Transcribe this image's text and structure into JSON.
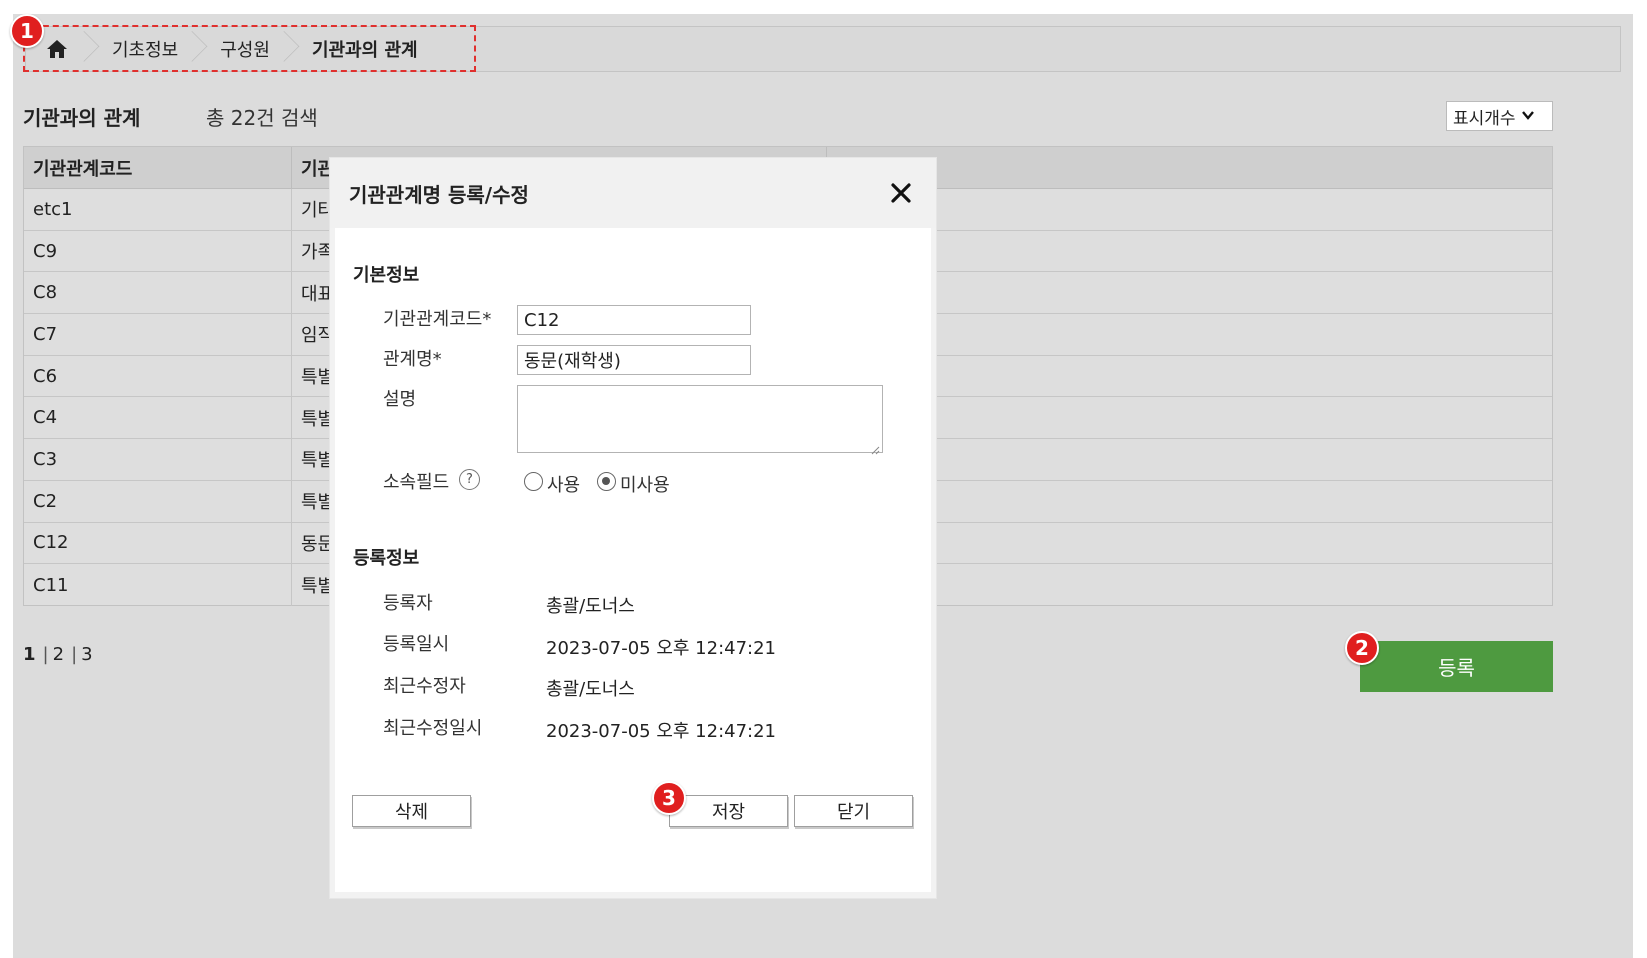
{
  "breadcrumb": {
    "items": [
      "기초정보",
      "구성원",
      "기관과의 관계"
    ]
  },
  "badges": {
    "one": "1",
    "two": "2",
    "three": "3"
  },
  "page": {
    "title": "기관과의 관계",
    "count": "총 22건 검색",
    "display_select": "표시개수"
  },
  "table": {
    "headers": [
      "기관관계코드",
      "기관",
      ""
    ],
    "rows": [
      {
        "code": "etc1",
        "name": "기타"
      },
      {
        "code": "C9",
        "name": "가족"
      },
      {
        "code": "C8",
        "name": "대표"
      },
      {
        "code": "C7",
        "name": "임직"
      },
      {
        "code": "C6",
        "name": "특별"
      },
      {
        "code": "C4",
        "name": "특별"
      },
      {
        "code": "C3",
        "name": "특별"
      },
      {
        "code": "C2",
        "name": "특별"
      },
      {
        "code": "C12",
        "name": "동문"
      },
      {
        "code": "C11",
        "name": "특별"
      }
    ]
  },
  "pagination": {
    "pages": [
      "1",
      "2",
      "3"
    ],
    "current": "1"
  },
  "register_button": "등록",
  "modal": {
    "title": "기관관계명 등록/수정",
    "basic_section": "기본정보",
    "code_label": "기관관계코드*",
    "code_value": "C12",
    "name_label": "관계명*",
    "name_value": "동문(재학생)",
    "desc_label": "설명",
    "field_label": "소속필드",
    "help_glyph": "?",
    "radio_use": "사용",
    "radio_unused": "미사용",
    "reg_section": "등록정보",
    "registrant_label": "등록자",
    "registrant_value": "총괄/도너스",
    "reg_date_label": "등록일시",
    "reg_date_value": "2023-07-05 오후 12:47:21",
    "modifier_label": "최근수정자",
    "modifier_value": "총괄/도너스",
    "mod_date_label": "최근수정일시",
    "mod_date_value": "2023-07-05 오후 12:47:21",
    "delete_button": "삭제",
    "save_button": "저장",
    "close_button": "닫기"
  },
  "colors": {
    "accent_green": "#4e9a40",
    "badge_red": "#e01f1f",
    "highlight_red": "#e0302e"
  }
}
